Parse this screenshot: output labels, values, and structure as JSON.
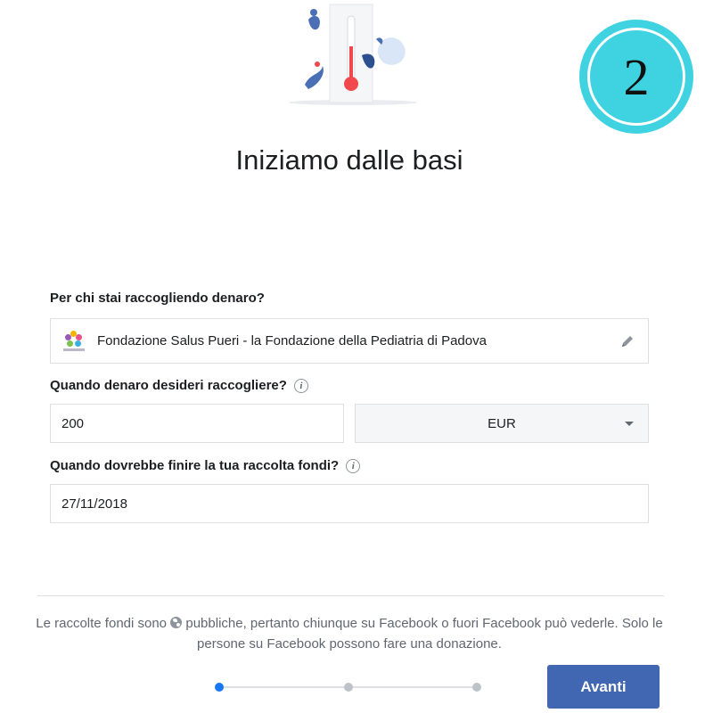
{
  "step_badge": {
    "number": "2"
  },
  "header": {
    "title": "Iniziamo dalle basi"
  },
  "form": {
    "beneficiary": {
      "label": "Per chi stai raccogliendo denaro?",
      "value": "Fondazione Salus Pueri - la Fondazione della Pediatria di Padova",
      "logo_icon": "organization-logo",
      "edit_icon": "pencil-icon"
    },
    "amount": {
      "label": "Quando denaro desideri raccogliere?",
      "info_icon": "info-icon",
      "value": "200",
      "currency": "EUR"
    },
    "end_date": {
      "label": "Quando dovrebbe finire la tua raccolta fondi?",
      "info_icon": "info-icon",
      "value": "27/11/2018"
    }
  },
  "footer": {
    "notice_part1": "Le raccolte fondi sono",
    "notice_part2": "pubbliche, pertanto chiunque su Facebook o fuori Facebook può vederle. Solo le persone su Facebook possono fare una donazione.",
    "globe_icon": "globe-icon",
    "progress": {
      "current_step": 1,
      "total_steps": 3
    },
    "next_button": "Avanti"
  },
  "colors": {
    "accent": "#4267b2",
    "active_step": "#1877f2",
    "badge": "#3fd3e2"
  }
}
